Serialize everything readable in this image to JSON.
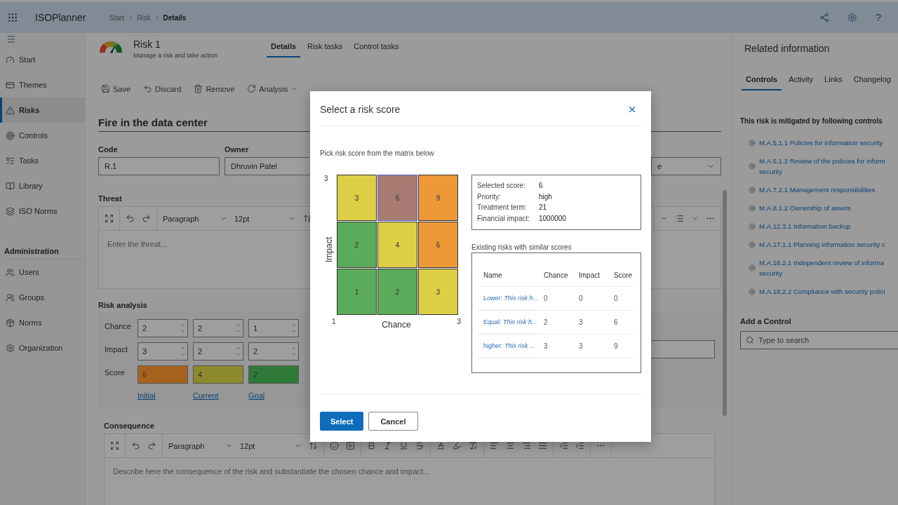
{
  "app": {
    "name": "ISOPlanner",
    "help_glyph": "?"
  },
  "breadcrumb": [
    {
      "label": "Start",
      "current": false
    },
    {
      "label": "Risk",
      "current": false
    },
    {
      "label": "Details",
      "current": true
    }
  ],
  "sidebar": {
    "items": [
      {
        "label": "Start",
        "selected": false
      },
      {
        "label": "Themes",
        "selected": false
      },
      {
        "label": "Risks",
        "selected": true
      },
      {
        "label": "Controls",
        "selected": false
      },
      {
        "label": "Tasks",
        "selected": false
      },
      {
        "label": "Library",
        "selected": false
      },
      {
        "label": "ISO Norms",
        "selected": false
      }
    ],
    "section": "Administration",
    "admin_items": [
      {
        "label": "Users",
        "selected": false
      },
      {
        "label": "Groups",
        "selected": false
      },
      {
        "label": "Norms",
        "selected": false
      },
      {
        "label": "Organization",
        "selected": false
      }
    ]
  },
  "page": {
    "title": "Risk 1",
    "subtitle": "Manage a risk and take action",
    "tabs": [
      {
        "label": "Details",
        "selected": true
      },
      {
        "label": "Risk tasks",
        "selected": false
      },
      {
        "label": "Control tasks",
        "selected": false
      }
    ]
  },
  "actions": [
    {
      "label": "Save",
      "dropdown": false
    },
    {
      "label": "Discard",
      "dropdown": false
    },
    {
      "label": "Remove",
      "dropdown": false
    },
    {
      "label": "Analysis",
      "dropdown": true
    }
  ],
  "risk_title": "Fire in the data center",
  "fields": [
    {
      "label": "Code",
      "value": "R.1"
    },
    {
      "label": "Owner",
      "value": "Dhruvin Patel"
    }
  ],
  "field_3": {
    "value": "e"
  },
  "threat": {
    "label": "Threat",
    "placeholder": "Enter the threat...",
    "block_format": "Paragraph",
    "font_size": "12pt"
  },
  "risk_analysis": {
    "label": "Risk analysis",
    "rows": [
      {
        "label": "Chance",
        "values": [
          "2",
          "2",
          "1"
        ]
      },
      {
        "label": "Impact",
        "values": [
          "3",
          "2",
          "2"
        ]
      }
    ],
    "score": {
      "label": "Score",
      "cells": [
        {
          "value": "6",
          "color": "#a8621f"
        },
        {
          "value": "4",
          "color": "#8c8a2c"
        },
        {
          "value": "2",
          "color": "#2f7a38"
        }
      ]
    },
    "links": [
      "Initial",
      "Current",
      "Goal"
    ]
  },
  "consequence": {
    "label": "Consequence",
    "placeholder": "Describe here the consequence of the risk and substantiate the chosen chance and impact...",
    "block_format": "Paragraph",
    "font_size": "12pt"
  },
  "related": {
    "title": "Related information",
    "tabs": [
      {
        "label": "Controls",
        "selected": true
      },
      {
        "label": "Activity",
        "selected": false
      },
      {
        "label": "Links",
        "selected": false
      },
      {
        "label": "Changelog",
        "selected": false
      }
    ],
    "intro": "This risk is mitigated by following controls",
    "controls": [
      {
        "lines": [
          "M.A.5.1.1 Policies for information security"
        ]
      },
      {
        "lines": [
          "M.A.5.1.2 Review of the policies for inform",
          "security"
        ]
      },
      {
        "lines": [
          "M.A.7.2.1 Management responsibilities"
        ]
      },
      {
        "lines": [
          "M.A.8.1.2 Ownership of assets"
        ]
      },
      {
        "lines": [
          "M.A.12.3.1 Information backup"
        ]
      },
      {
        "lines": [
          "M.A.17.1.1 Planning information security c"
        ]
      },
      {
        "lines": [
          "M.A.18.2.1 Independent review of informa",
          "security"
        ]
      },
      {
        "lines": [
          "M.A.18.2.2 Compliance with security polici"
        ]
      }
    ],
    "add_label": "Add a Control",
    "search": {
      "placeholder": "Type to search"
    }
  },
  "dialog": {
    "title": "Select a risk score",
    "instruction": "Pick risk score from the matrix below",
    "matrix": {
      "y_label": "Impact",
      "y_max": "3",
      "x_label": "Chance",
      "x_min": "1",
      "x_max": "3",
      "rows": [
        {
          "cells": [
            {
              "value": "3",
              "color": "#dccf45",
              "selected": false
            },
            {
              "value": "6",
              "color": "#a87b73",
              "selected": true
            },
            {
              "value": "9",
              "color": "#ee9838",
              "selected": false
            }
          ]
        },
        {
          "cells": [
            {
              "value": "2",
              "color": "#5aab5a",
              "selected": false
            },
            {
              "value": "4",
              "color": "#dccf45",
              "selected": false
            },
            {
              "value": "6",
              "color": "#ee9838",
              "selected": false
            }
          ]
        },
        {
          "cells": [
            {
              "value": "1",
              "color": "#5aab5a",
              "selected": false
            },
            {
              "value": "2",
              "color": "#5aab5a",
              "selected": false
            },
            {
              "value": "3",
              "color": "#dccf45",
              "selected": false
            }
          ]
        }
      ]
    },
    "details": [
      {
        "label": "Selected score:",
        "value": "6"
      },
      {
        "label": "Priority:",
        "value": "high"
      },
      {
        "label": "Treatment term:",
        "value": "21"
      },
      {
        "label": "Financial impact:",
        "value": "1000000"
      }
    ],
    "similar_title": "Existing risks with similar scores",
    "table": {
      "columns": [
        "Name",
        "Chance",
        "Impact",
        "Score"
      ],
      "rows": [
        {
          "name": "Lower: *This risk h...*",
          "chance": "0",
          "impact": "0",
          "score": "0"
        },
        {
          "name": "Equal: *This risk h...*",
          "chance": "2",
          "impact": "3",
          "score": "6"
        },
        {
          "name": "higher: *This risk ...*",
          "chance": "3",
          "impact": "3",
          "score": "9"
        }
      ]
    },
    "buttons": [
      {
        "label": "Select",
        "primary": true
      },
      {
        "label": "Cancel",
        "primary": false
      }
    ]
  }
}
